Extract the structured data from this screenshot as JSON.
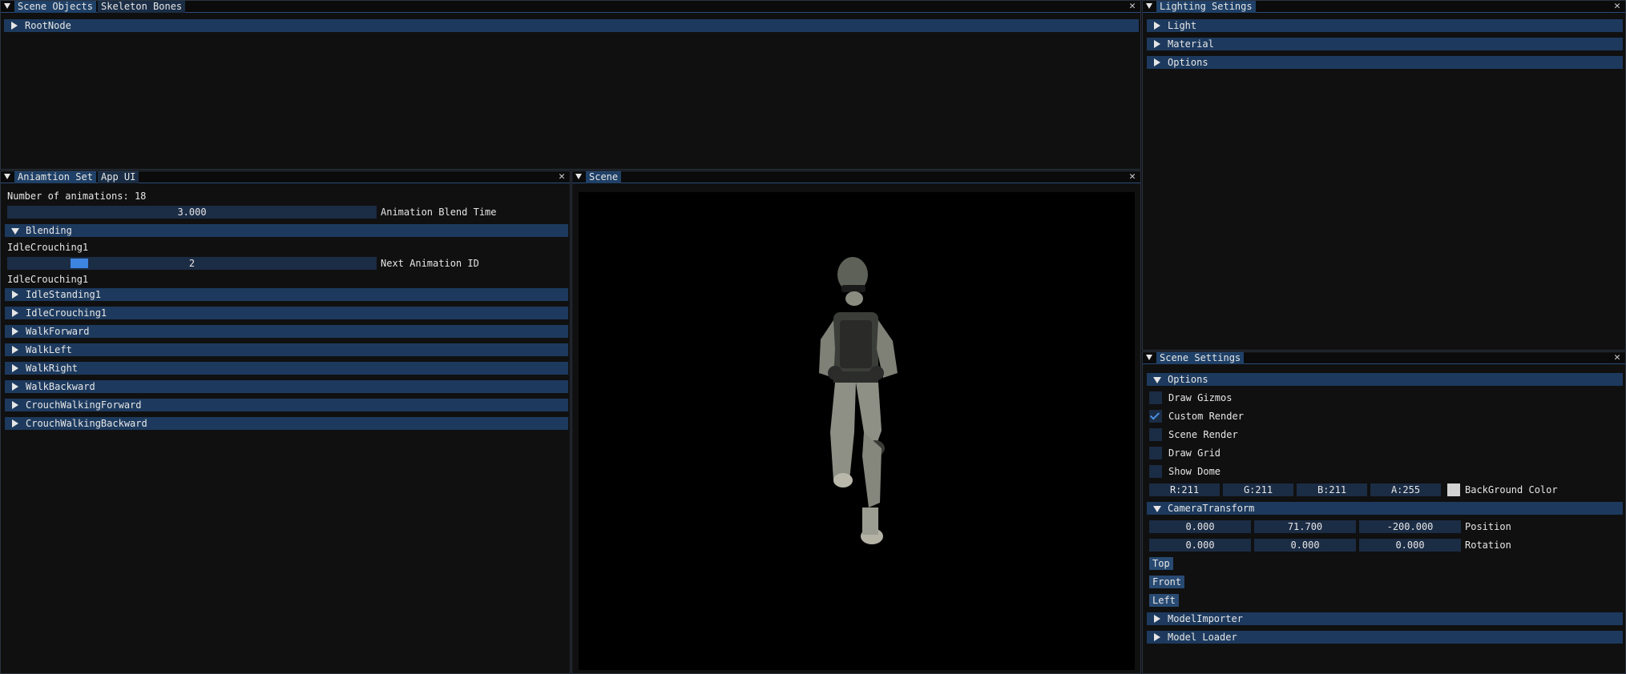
{
  "scene_objects_panel": {
    "tabs": [
      "Scene Objects",
      "Skeleton Bones"
    ],
    "tree": [
      {
        "label": "RootNode",
        "expanded": false
      }
    ]
  },
  "lighting_panel": {
    "title": "Lighting Setings",
    "sections": [
      "Light",
      "Material",
      "Options"
    ]
  },
  "animation_panel": {
    "tabs": [
      "Aniamtion Set",
      "App UI"
    ],
    "num_animations_label": "Number of animations: 18",
    "blend_time": {
      "value": "3.000",
      "label": "Animation Blend Time"
    },
    "blending": {
      "header": "Blending",
      "current": "IdleCrouching1",
      "next_id": {
        "value": "2",
        "label": "Next Animation ID",
        "fraction": 0.18
      },
      "next_name": "IdleCrouching1"
    },
    "animations": [
      "IdleStanding1",
      "IdleCrouching1",
      "WalkForward",
      "WalkLeft",
      "WalkRight",
      "WalkBackward",
      "CrouchWalkingForward",
      "CrouchWalkingBackward"
    ]
  },
  "scene_panel": {
    "title": "Scene"
  },
  "scene_settings_panel": {
    "title": "Scene Settings",
    "options_header": "Options",
    "checkboxes": [
      {
        "label": "Draw Gizmos",
        "checked": false
      },
      {
        "label": "Custom Render",
        "checked": true
      },
      {
        "label": "Scene Render",
        "checked": false
      },
      {
        "label": "Draw Grid",
        "checked": false
      },
      {
        "label": "Show Dome",
        "checked": false
      }
    ],
    "bg_color": {
      "r": "R:211",
      "g": "G:211",
      "b": "B:211",
      "a": "A:255",
      "label": "BackGround Color",
      "swatch": "#d3d3d3"
    },
    "camera_header": "CameraTransform",
    "position": {
      "x": "0.000",
      "y": "71.700",
      "z": "-200.000",
      "label": "Position"
    },
    "rotation": {
      "x": "0.000",
      "y": "0.000",
      "z": "0.000",
      "label": "Rotation"
    },
    "view_buttons": [
      "Top",
      "Front",
      "Left"
    ],
    "model_importer": "ModelImporter",
    "model_loader": "Model Loader"
  },
  "colors": {
    "header": "#1d3a5e",
    "accent": "#4a90e2",
    "background": "#101010"
  }
}
